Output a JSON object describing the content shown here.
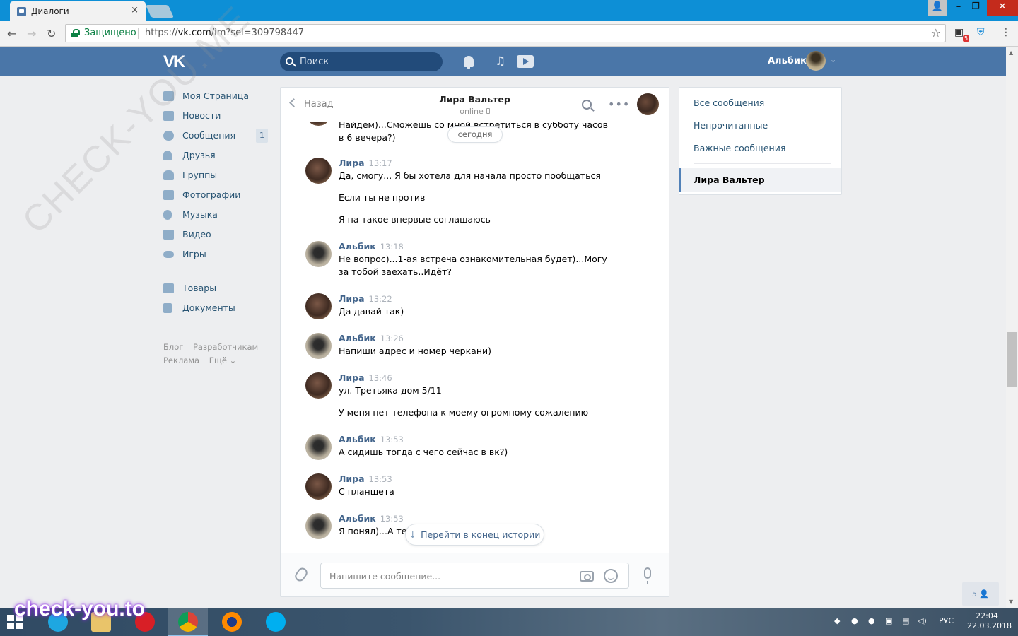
{
  "browser": {
    "tab_title": "Диалоги",
    "tab_close": "×",
    "secure_label": "Защищено",
    "url_prefix": "https://",
    "url_host": "vk.com",
    "url_path": "/im?sel=309798447",
    "ext_badge": "5"
  },
  "header": {
    "logo": "VK",
    "search_placeholder": "Поиск",
    "user_name": "Альбик"
  },
  "left_menu": {
    "items": [
      {
        "label": "Моя Страница"
      },
      {
        "label": "Новости"
      },
      {
        "label": "Сообщения",
        "badge": "1"
      },
      {
        "label": "Друзья"
      },
      {
        "label": "Группы"
      },
      {
        "label": "Фотографии"
      },
      {
        "label": "Музыка"
      },
      {
        "label": "Видео"
      },
      {
        "label": "Игры"
      }
    ],
    "items2": [
      {
        "label": "Товары"
      },
      {
        "label": "Документы"
      }
    ],
    "footer": [
      "Блог",
      "Разработчикам",
      "Реклама",
      "Ещё ⌄"
    ]
  },
  "chat": {
    "back_label": "Назад",
    "contact_name": "Лира Вальтер",
    "contact_status": "online",
    "date_pill": "сегодня",
    "partial_text": "Найдем)...Сможешь со мной встретиться в субботу часов в 6 вечера?)",
    "messages": [
      {
        "author": "Лира",
        "time": "13:17",
        "lines": [
          "Да, смогу... Я бы хотела для начала просто пообщаться",
          "Если ты не против",
          "Я на такое впервые соглашаюсь"
        ]
      },
      {
        "author": "Альбик",
        "time": "13:18",
        "lines": [
          "Не вопрос)...1-ая встреча ознакомительная будет)...Могу за тобой заехать..Идёт?"
        ]
      },
      {
        "author": "Лира",
        "time": "13:22",
        "lines": [
          "Да давай так)"
        ]
      },
      {
        "author": "Альбик",
        "time": "13:26",
        "lines": [
          "Напиши адрес и номер черкани)"
        ]
      },
      {
        "author": "Лира",
        "time": "13:46",
        "lines": [
          "ул. Третьяка дом 5/11",
          "У меня нет телефона к моему огромному сожалению"
        ]
      },
      {
        "author": "Альбик",
        "time": "13:53",
        "lines": [
          "А сидишь тогда с чего сейчас в вк?)"
        ]
      },
      {
        "author": "Лира",
        "time": "13:53",
        "lines": [
          "С планшета"
        ]
      },
      {
        "author": "Альбик",
        "time": "13:53",
        "lines": [
          "Я понял)...А тел"
        ]
      }
    ],
    "goto_end": "Перейти в конец истории",
    "input_placeholder": "Напишите сообщение..."
  },
  "right_menu": {
    "items": [
      "Все сообщения",
      "Непрочитанные",
      "Важные сообщения"
    ],
    "active": "Лира Вальтер"
  },
  "online_count": "5",
  "watermark": "CHECK-YOU.ME",
  "watermark2": "check-you.to",
  "taskbar": {
    "lang": "РУС",
    "time": "22:04",
    "date": "22.03.2018"
  },
  "colors": {
    "vk_blue": "#4a76a8",
    "link": "#42648b",
    "chrome_blue": "#0d8fd6"
  }
}
